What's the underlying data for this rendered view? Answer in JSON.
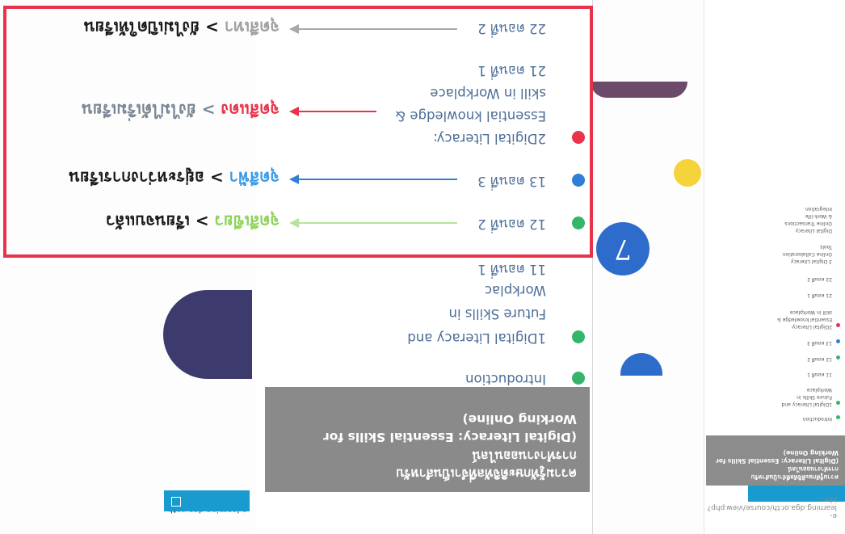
{
  "mini": {
    "address": "e-learning.dga.or.th/course/view.php?id=...",
    "title_lines": [
      "ความรู้ทักษะดิจิทัลที่จำเป็นสำหรับ",
      "การทำงานออนไลน์",
      "(Digital Literacy: Essential Skills for",
      "Working Online)"
    ],
    "items": [
      "Introduction",
      "1Digital Literacy and",
      "Future Skills in",
      "Workplace",
      "11 ตอนที่ 1",
      "12 ตอนที่ 2",
      "13 ตอนที่ 3",
      "2Digital Literacy:",
      "Essential knowledge &",
      "skill in Workplace",
      "21 ตอนที่ 1",
      "22 ตอนที่ 2",
      "3 Digital Literacy",
      "Online Collaboration",
      "Tools",
      "Digital Literacy",
      "Online Transactions",
      "& Work-life",
      "Integration"
    ]
  },
  "browser": {
    "site": "e-learning.dga.or.th"
  },
  "slide": {
    "title_lines": [
      "ความรู้ทักษะดิจิทัลที่จำเป็นสำหรับ",
      "การทำงานออนไลน์",
      "(Digital Literacy: Essential Skills for",
      "Working Online)"
    ]
  },
  "outline": {
    "intro": "Introduction",
    "module1_lines": [
      "1Digital Literacy and",
      "Future Skills in",
      "Workplac"
    ],
    "m1_part1": "11 ตอนที่ 1",
    "m1_part2": "12 ตอนที่ 2",
    "m1_part3": "13 ตอนที่ 3",
    "module2_lines": [
      "2Digital Literacy:",
      "Essential knowledge &",
      "skill in Workplace"
    ],
    "m2_part1": "21 ตอนที่ 1",
    "m2_part2": "22 ตอนที่ 2"
  },
  "legend": {
    "done_color": "จุดสีเขียว",
    "done_text": " > เรียนจบแล้ว",
    "inprogress_color": "จุดสีฟ้า",
    "inprogress_text": " > อยู่ระหว่างการเรียน",
    "notstarted_color": "จุดสีแดง",
    "notstarted_text": " > ยังไม่ได้เริ่มเรียน",
    "locked_color": "จุดสีเทา",
    "locked_text": " > ยังไม่เปิดให้เรียน"
  },
  "badge": {
    "number": "7"
  },
  "colors": {
    "green": "#36b46a",
    "blue": "#2f7fd6",
    "red": "#e8334a",
    "gray": "#a0a0a0",
    "green_text": "#8fd35a",
    "blue_text": "#3b9be6"
  }
}
